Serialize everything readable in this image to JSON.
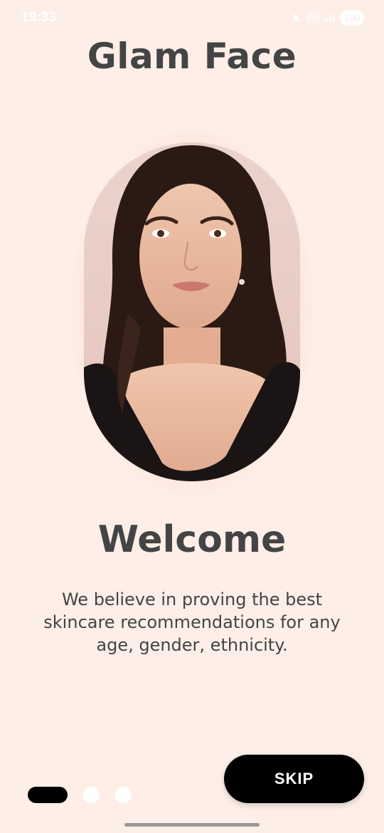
{
  "status_bar": {
    "time": "19:33",
    "battery": "100",
    "network": "5G",
    "icons": [
      "mute-icon",
      "5g-icon",
      "signal-icon",
      "battery-icon"
    ]
  },
  "app": {
    "title": "Glam Face"
  },
  "onboarding": {
    "image": "portrait-photo",
    "title": "Welcome",
    "description": "We believe in proving the best skincare recommendations for any age, gender, ethnicity.",
    "page_index": 1,
    "page_count": 3,
    "skip_label": "SKIP"
  },
  "colors": {
    "background": "#fdeee8",
    "text": "#444444",
    "button": "#000000",
    "button_text": "#ffffff",
    "inactive_dot": "#ffffff"
  }
}
